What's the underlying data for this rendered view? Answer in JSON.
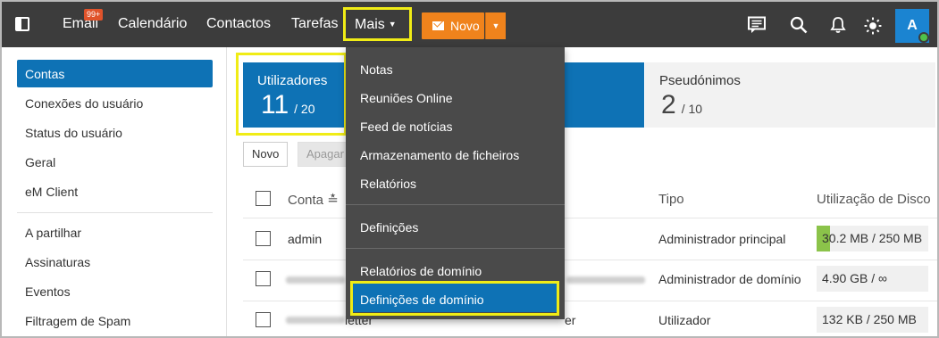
{
  "topbar": {
    "nav": [
      "Email",
      "Calendário",
      "Contactos",
      "Tarefas"
    ],
    "email_badge": "99+",
    "more_label": "Mais",
    "new_label": "Novo",
    "avatar_initial": "A",
    "bg_color": "#3c3c3c",
    "accent_color": "#f0831c"
  },
  "sidebar": {
    "items": [
      "Contas",
      "Conexões do usuário",
      "Status do usuário",
      "Geral",
      "eM Client"
    ],
    "items2": [
      "A partilhar",
      "Assinaturas",
      "Eventos",
      "Filtragem de Spam"
    ],
    "active": "Contas",
    "active_color": "#0e72b5"
  },
  "stats": {
    "users_label": "Utilizadores",
    "users_count": "11",
    "users_total": "/ 20",
    "aliases_label": "Pseudónimos",
    "aliases_count": "2",
    "aliases_total": "/ 10"
  },
  "toolbar": {
    "new_label": "Novo",
    "delete_label": "Apagar"
  },
  "table": {
    "headers": {
      "account": "Conta ≛",
      "type": "Tipo",
      "disk": "Utilização de Disco"
    },
    "rows": [
      {
        "account": "admin",
        "type": "Administrador principal",
        "disk": "30.2 MB / 250 MB",
        "disk_fill": 0.12
      },
      {
        "account": "",
        "type": "Administrador de domínio",
        "disk": "4.90 GB / ∞",
        "disk_fill": 0
      },
      {
        "account": "letter",
        "name_suffix": "er",
        "type": "Utilizador",
        "disk": "132 KB / 250 MB",
        "disk_fill": 0
      }
    ]
  },
  "menu": {
    "items": [
      "Notas",
      "Reuniões Online",
      "Feed de notícias",
      "Armazenamento de ficheiros",
      "Relatórios"
    ],
    "settings": "Definições",
    "domain_items": [
      "Relatórios de domínio",
      "Definições de domínio"
    ],
    "selected": "Definições de domínio",
    "bg_color": "#4a4a4a",
    "highlight_color": "#f0ec16"
  }
}
